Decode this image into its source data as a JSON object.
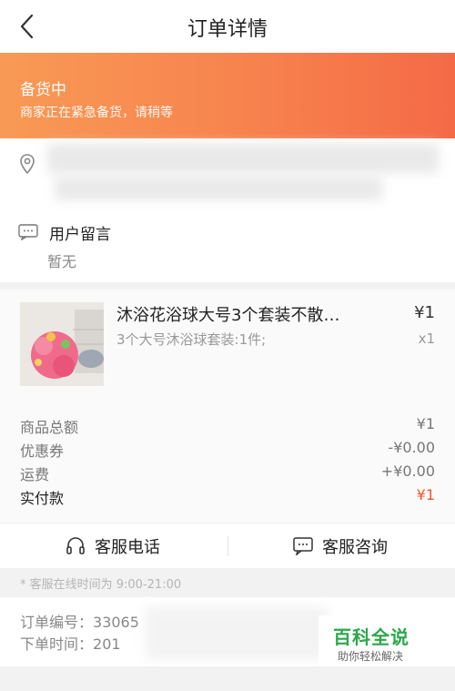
{
  "nav": {
    "title": "订单详情",
    "back_icon": "chevron-left-icon"
  },
  "status": {
    "title": "备货中",
    "description": "商家正在紧急备货，请稍等"
  },
  "address": {
    "icon": "location-pin-icon"
  },
  "message": {
    "icon": "message-icon",
    "title": "用户留言",
    "value": "暂无"
  },
  "product": {
    "name": "沐浴花浴球大号3个套装不散…",
    "spec": "3个大号沐浴球套装:1件;",
    "price": "¥1",
    "quantity": "x1"
  },
  "fees": [
    {
      "label": "商品总额",
      "value": "¥1"
    },
    {
      "label": "优惠券",
      "value": "-¥0.00"
    },
    {
      "label": "运费",
      "value": "+¥0.00"
    },
    {
      "label": "实付款",
      "value": "¥1"
    }
  ],
  "service": {
    "phone_label": "客服电话",
    "phone_icon": "headset-icon",
    "chat_label": "客服咨询",
    "chat_icon": "chat-bubble-icon"
  },
  "hours_note": "* 客服在线时间为 9:00-21:00",
  "order_info": {
    "number_label": "订单编号：",
    "number_value": "33065",
    "time_label": "下单时间：",
    "time_value": "201"
  },
  "watermark": {
    "title": "百科全说",
    "subtitle": "助你轻松解决"
  },
  "colors": {
    "banner_start": "#f89a55",
    "banner_end": "#f46a47",
    "accent": "#f2552c",
    "watermark": "#2aa84a"
  }
}
